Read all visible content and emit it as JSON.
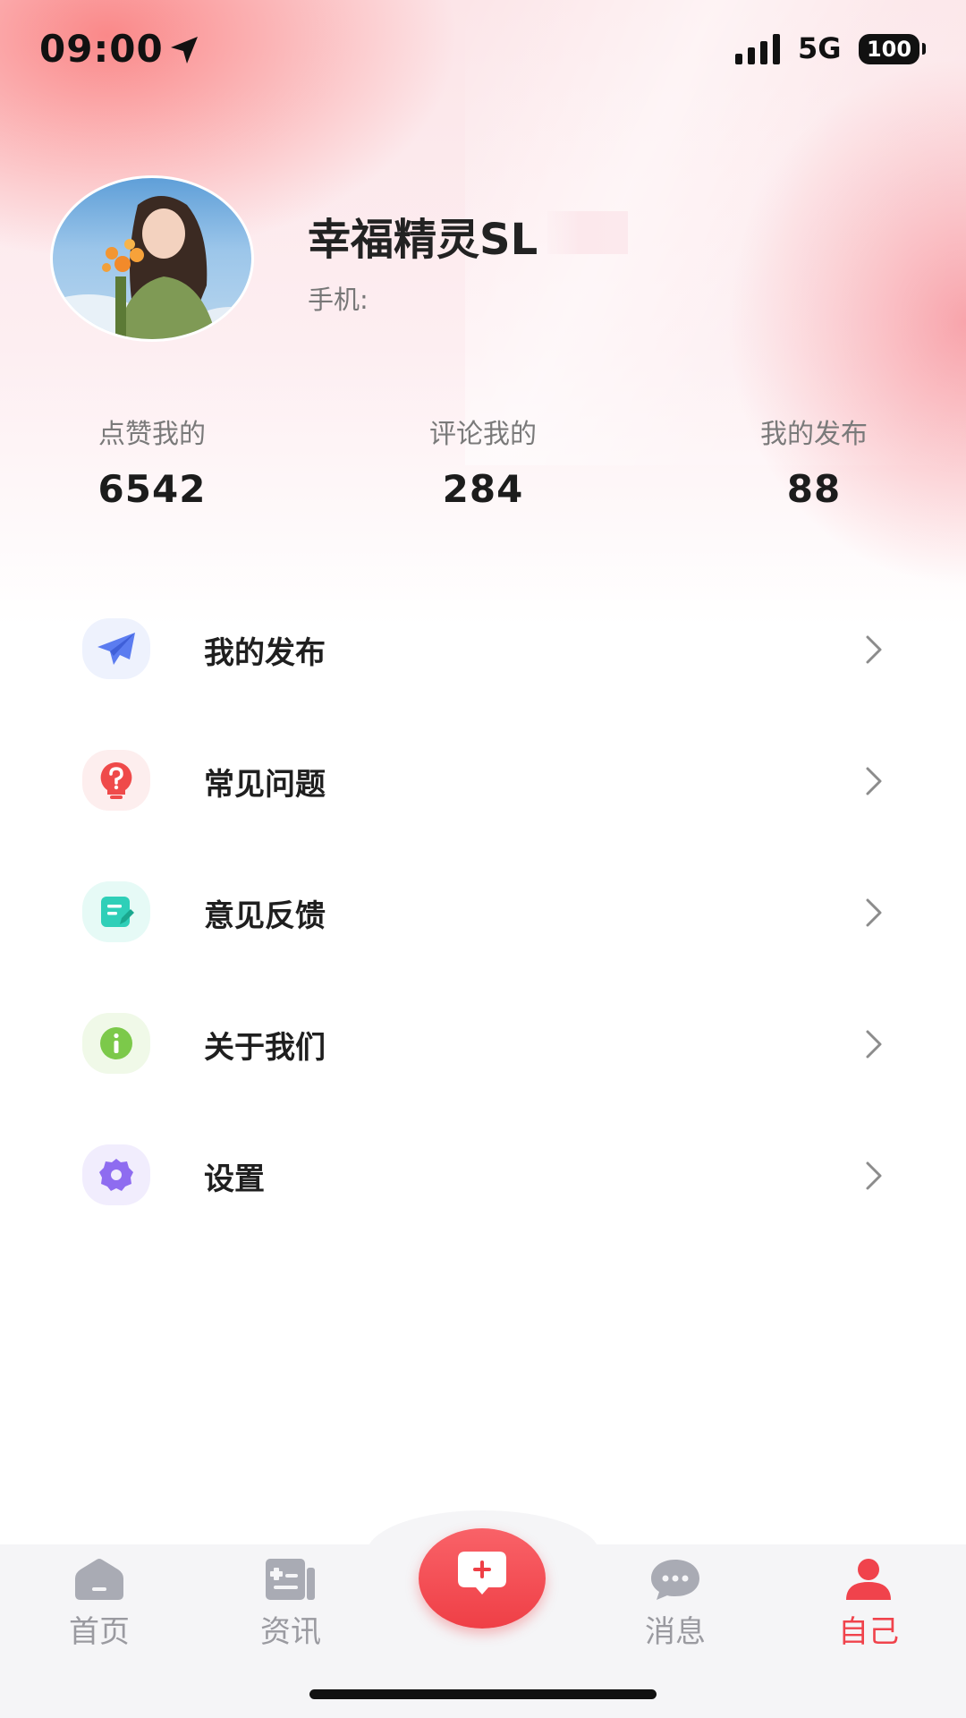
{
  "status_bar": {
    "time": "09:00",
    "network": "5G",
    "battery": "100"
  },
  "profile": {
    "username": "幸福精灵SL",
    "phone_label": "手机:"
  },
  "stats": [
    {
      "label": "点赞我的",
      "value": "6542"
    },
    {
      "label": "评论我的",
      "value": "284"
    },
    {
      "label": "我的发布",
      "value": "88"
    }
  ],
  "menu": [
    {
      "label": "我的发布",
      "icon": "paper-plane-icon",
      "color": "#5b7cf0",
      "bg": "#eef2fd"
    },
    {
      "label": "常见问题",
      "icon": "question-bulb-icon",
      "color": "#ef4a4a",
      "bg": "#fdeeee"
    },
    {
      "label": "意见反馈",
      "icon": "feedback-note-icon",
      "color": "#2fcfb8",
      "bg": "#e6faf6"
    },
    {
      "label": "关于我们",
      "icon": "info-icon",
      "color": "#7cc94a",
      "bg": "#f0f9e8"
    },
    {
      "label": "设置",
      "icon": "gear-icon",
      "color": "#8e6cf0",
      "bg": "#f1edfd"
    }
  ],
  "tabbar": {
    "tabs": [
      {
        "label": "首页",
        "icon": "home-icon",
        "active": false
      },
      {
        "label": "资讯",
        "icon": "news-icon",
        "active": false
      },
      {
        "label": "消息",
        "icon": "chat-icon",
        "active": false
      },
      {
        "label": "自己",
        "icon": "user-icon",
        "active": true
      }
    ],
    "fab_icon": "add-post-icon",
    "active_color": "#f0434c",
    "inactive_color": "#9a9aa0"
  }
}
